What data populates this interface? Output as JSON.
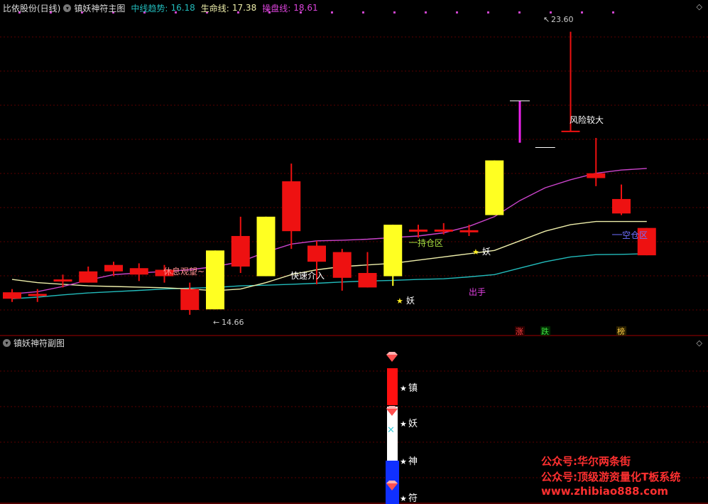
{
  "header": {
    "stock_name": "比依股份(日线)",
    "indicator_name": "镇妖神符主图",
    "mid_trend_label": "中线趋势:",
    "mid_trend_value": "16.18",
    "life_line_label": "生命线:",
    "life_line_value": "17.38",
    "trade_line_label": "操盘线:",
    "trade_line_value": "18.61"
  },
  "sub_header": {
    "indicator_name": "镇妖神符副图"
  },
  "colors": {
    "background": "#000000",
    "up_candle": "#ee1111",
    "special_candle": "#ffff22",
    "mid_trend": "#22bbbb",
    "life_line": "#eeeeaa",
    "trade_line": "#cc44cc",
    "grid": "#5a0000",
    "separator": "#a00000",
    "watermark": "#ff3030"
  },
  "chart_data": {
    "type": "candlestick",
    "title": "比依股份(日线)",
    "candles": [
      {
        "o": 15.3,
        "c": 15.5,
        "h": 15.6,
        "l": 15.2,
        "kind": "red"
      },
      {
        "o": 15.4,
        "c": 15.45,
        "h": 15.6,
        "l": 15.2,
        "kind": "red"
      },
      {
        "o": 15.85,
        "c": 15.9,
        "h": 16.05,
        "l": 15.65,
        "kind": "red"
      },
      {
        "o": 15.8,
        "c": 16.15,
        "h": 16.3,
        "l": 15.8,
        "kind": "red"
      },
      {
        "o": 16.15,
        "c": 16.35,
        "h": 16.45,
        "l": 16.0,
        "kind": "red"
      },
      {
        "o": 16.05,
        "c": 16.25,
        "h": 16.4,
        "l": 15.85,
        "kind": "red"
      },
      {
        "o": 16.0,
        "c": 16.2,
        "h": 16.35,
        "l": 15.8,
        "kind": "red"
      },
      {
        "o": 15.6,
        "c": 14.95,
        "h": 15.8,
        "l": 14.8,
        "kind": "red"
      },
      {
        "o": 14.97,
        "c": 16.8,
        "h": 16.8,
        "l": 14.97,
        "kind": "yellow"
      },
      {
        "o": 16.3,
        "c": 17.25,
        "h": 17.85,
        "l": 16.1,
        "kind": "red"
      },
      {
        "o": 16.0,
        "c": 17.85,
        "h": 17.85,
        "l": 16.0,
        "kind": "yellow"
      },
      {
        "o": 17.4,
        "c": 18.95,
        "h": 19.5,
        "l": 16.85,
        "kind": "red"
      },
      {
        "o": 16.95,
        "c": 16.45,
        "h": 17.1,
        "l": 15.75,
        "kind": "red"
      },
      {
        "o": 16.75,
        "c": 15.95,
        "h": 16.85,
        "l": 15.55,
        "kind": "red"
      },
      {
        "o": 16.1,
        "c": 15.65,
        "h": 16.75,
        "l": 15.65,
        "kind": "red"
      },
      {
        "o": 16.0,
        "c": 17.6,
        "h": 17.6,
        "l": 15.7,
        "kind": "yellow"
      },
      {
        "o": 17.45,
        "c": 17.45,
        "h": 17.6,
        "l": 17.2,
        "kind": "red"
      },
      {
        "o": 17.45,
        "c": 17.45,
        "h": 17.65,
        "l": 17.3,
        "kind": "red"
      },
      {
        "o": 17.4,
        "c": 17.43,
        "h": 17.6,
        "l": 17.25,
        "kind": "red"
      },
      {
        "o": 17.9,
        "c": 19.6,
        "h": 19.6,
        "l": 17.9,
        "kind": "yellow"
      },
      {
        "o": 20.2,
        "c": 21.2,
        "h": 21.45,
        "l": 20.15,
        "kind": "magenta"
      },
      {
        "o": 20.0,
        "c": 20.0,
        "h": 20.0,
        "l": 20.0,
        "kind": "white-dash"
      },
      {
        "o": 20.5,
        "c": 20.5,
        "h": 23.6,
        "l": 20.5,
        "kind": "red"
      },
      {
        "o": 19.2,
        "c": 19.05,
        "h": 20.3,
        "l": 18.8,
        "kind": "red"
      },
      {
        "o": 18.4,
        "c": 17.95,
        "h": 18.85,
        "l": 17.9,
        "kind": "red"
      },
      {
        "o": 17.5,
        "c": 16.65,
        "h": 17.5,
        "l": 16.65,
        "kind": "red"
      }
    ],
    "mid_trend_line": [
      15.3,
      15.35,
      15.42,
      15.48,
      15.52,
      15.56,
      15.6,
      15.63,
      15.65,
      15.7,
      15.72,
      15.75,
      15.78,
      15.82,
      15.85,
      15.87,
      15.9,
      15.92,
      15.98,
      16.05,
      16.25,
      16.45,
      16.6,
      16.67,
      16.68,
      16.7
    ],
    "life_line": [
      15.9,
      15.8,
      15.75,
      15.7,
      15.68,
      15.66,
      15.64,
      15.6,
      15.55,
      15.6,
      15.8,
      16.05,
      16.2,
      16.3,
      16.35,
      16.4,
      16.5,
      16.6,
      16.7,
      16.8,
      17.1,
      17.4,
      17.6,
      17.7,
      17.7,
      17.7
    ],
    "trade_line": [
      15.45,
      15.52,
      15.68,
      15.88,
      16.05,
      16.1,
      16.15,
      16.2,
      16.3,
      16.45,
      16.75,
      17.0,
      17.1,
      17.12,
      17.15,
      17.2,
      17.25,
      17.35,
      17.55,
      17.85,
      18.35,
      18.75,
      19.0,
      19.2,
      19.3,
      19.35
    ],
    "ylim": [
      14.2,
      24.1
    ],
    "annotations": [
      {
        "text": "休息观望~",
        "color": "#ff8f8f"
      },
      {
        "text": "快速介入",
        "color": "#ffffff"
      },
      {
        "text": "持仓区",
        "color": "#a8e040"
      },
      {
        "text": "风险较大",
        "color": "#ffffff"
      },
      {
        "text": "空仓区",
        "color": "#7070ff"
      },
      {
        "text": "出手",
        "color": "#e040e0"
      },
      {
        "text": "妖",
        "color": "#ffffff"
      },
      {
        "text": "妖",
        "color": "#ffffff"
      }
    ],
    "price_marks": [
      {
        "text": "23.60"
      },
      {
        "text": "14.66"
      }
    ],
    "bottom_tags": [
      "涨",
      "跌",
      "榜"
    ],
    "sub_labels": [
      "镇",
      "妖",
      "神",
      "符"
    ]
  },
  "watermark": {
    "line1": "公众号:华尔两条街",
    "line2": "公众号:顶级游资量化T板系统",
    "line3": "www.zhibiao888.com"
  }
}
